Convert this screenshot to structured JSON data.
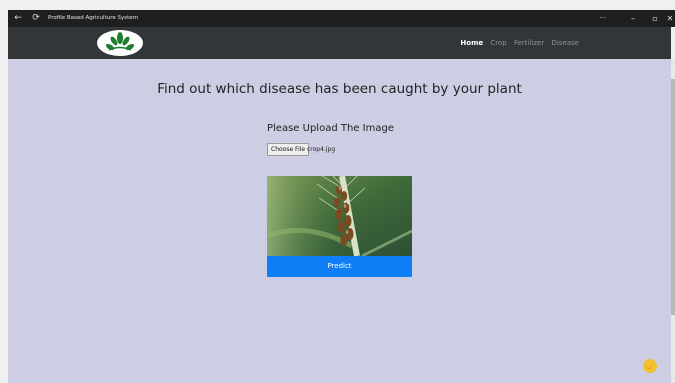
{
  "window": {
    "title": "Profile Based Agriculture System",
    "back_icon": "←",
    "reload_icon": "⟳",
    "more_icon": "···",
    "min_icon": "–",
    "max_icon": "▫",
    "close_icon": "✕"
  },
  "nav": {
    "items": [
      "Home",
      "Crop",
      "Fertilizer",
      "Disease"
    ],
    "active": "Home"
  },
  "main": {
    "heading": "Find out which disease has been caught by your plant",
    "upload_label": "Please Upload The Image",
    "file_button": "Choose File",
    "file_name": "crop4.jpg",
    "predict_label": "Predict"
  },
  "colors": {
    "titlebar": "#1f1f1f",
    "navbar": "#323638",
    "background": "#cdcde3",
    "predict_button": "#0d7ef5",
    "fab": "#f2c22e"
  }
}
